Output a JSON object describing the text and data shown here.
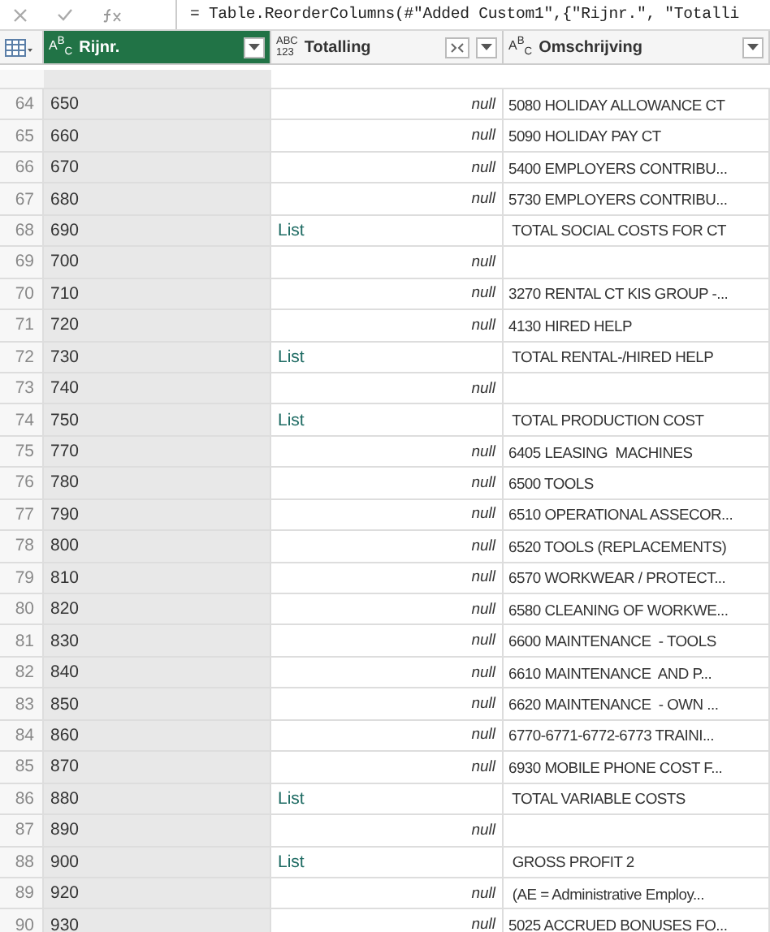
{
  "formula_bar": {
    "text": "= Table.ReorderColumns(#\"Added Custom1\",{\"Rijnr.\", \"Totalli"
  },
  "columns": [
    {
      "name": "Rijnr.",
      "kind": "text",
      "type_label": "A$^{B}$$_{C}$",
      "selected": true,
      "expandable": false
    },
    {
      "name": "Totalling",
      "kind": "any",
      "type_label": "ABC 123",
      "selected": false,
      "expandable": true
    },
    {
      "name": "Omschrijving",
      "kind": "text",
      "type_label": "A$^{B}$$_{C}$",
      "selected": false,
      "expandable": false
    }
  ],
  "rows": [
    {
      "n": "64",
      "rijnr": "650",
      "totalling": {
        "kind": "null",
        "text": "null"
      },
      "omschrijving": "5080 HOLIDAY ALLOWANCE CT"
    },
    {
      "n": "65",
      "rijnr": "660",
      "totalling": {
        "kind": "null",
        "text": "null"
      },
      "omschrijving": "5090 HOLIDAY PAY CT"
    },
    {
      "n": "66",
      "rijnr": "670",
      "totalling": {
        "kind": "null",
        "text": "null"
      },
      "omschrijving": "5400 EMPLOYERS CONTRIBU..."
    },
    {
      "n": "67",
      "rijnr": "680",
      "totalling": {
        "kind": "null",
        "text": "null"
      },
      "omschrijving": "5730 EMPLOYERS CONTRIBU..."
    },
    {
      "n": "68",
      "rijnr": "690",
      "totalling": {
        "kind": "list",
        "text": "List"
      },
      "omschrijving": " TOTAL SOCIAL COSTS FOR CT"
    },
    {
      "n": "69",
      "rijnr": "700",
      "totalling": {
        "kind": "null",
        "text": "null"
      }
    },
    {
      "n": "70",
      "rijnr": "710",
      "totalling": {
        "kind": "null",
        "text": "null"
      },
      "omschrijving": "3270 RENTAL CT KIS GROUP -..."
    },
    {
      "n": "71",
      "rijnr": "720",
      "totalling": {
        "kind": "null",
        "text": "null"
      },
      "omschrijving": "4130 HIRED HELP"
    },
    {
      "n": "72",
      "rijnr": "730",
      "totalling": {
        "kind": "list",
        "text": "List"
      },
      "omschrijving": " TOTAL RENTAL-/HIRED HELP"
    },
    {
      "n": "73",
      "rijnr": "740",
      "totalling": {
        "kind": "null",
        "text": "null"
      }
    },
    {
      "n": "74",
      "rijnr": "750",
      "totalling": {
        "kind": "list",
        "text": "List"
      },
      "omschrijving": " TOTAL PRODUCTION COST"
    },
    {
      "n": "75",
      "rijnr": "770",
      "totalling": {
        "kind": "null",
        "text": "null"
      },
      "omschrijving": "6405 LEASING  MACHINES"
    },
    {
      "n": "76",
      "rijnr": "780",
      "totalling": {
        "kind": "null",
        "text": "null"
      },
      "omschrijving": "6500 TOOLS"
    },
    {
      "n": "77",
      "rijnr": "790",
      "totalling": {
        "kind": "null",
        "text": "null"
      },
      "omschrijving": "6510 OPERATIONAL ASSECOR..."
    },
    {
      "n": "78",
      "rijnr": "800",
      "totalling": {
        "kind": "null",
        "text": "null"
      },
      "omschrijving": "6520 TOOLS (REPLACEMENTS)"
    },
    {
      "n": "79",
      "rijnr": "810",
      "totalling": {
        "kind": "null",
        "text": "null"
      },
      "omschrijving": "6570 WORKWEAR / PROTECT..."
    },
    {
      "n": "80",
      "rijnr": "820",
      "totalling": {
        "kind": "null",
        "text": "null"
      },
      "omschrijving": "6580 CLEANING OF WORKWE..."
    },
    {
      "n": "81",
      "rijnr": "830",
      "totalling": {
        "kind": "null",
        "text": "null"
      },
      "omschrijving": "6600 MAINTENANCE  - TOOLS"
    },
    {
      "n": "82",
      "rijnr": "840",
      "totalling": {
        "kind": "null",
        "text": "null"
      },
      "omschrijving": "6610 MAINTENANCE  AND P..."
    },
    {
      "n": "83",
      "rijnr": "850",
      "totalling": {
        "kind": "null",
        "text": "null"
      },
      "omschrijving": "6620 MAINTENANCE  - OWN ..."
    },
    {
      "n": "84",
      "rijnr": "860",
      "totalling": {
        "kind": "null",
        "text": "null"
      },
      "omschrijving": "6770-6771-6772-6773 TRAINI..."
    },
    {
      "n": "85",
      "rijnr": "870",
      "totalling": {
        "kind": "null",
        "text": "null"
      },
      "omschrijving": "6930 MOBILE PHONE COST F..."
    },
    {
      "n": "86",
      "rijnr": "880",
      "totalling": {
        "kind": "list",
        "text": "List"
      },
      "omschrijving": " TOTAL VARIABLE COSTS"
    },
    {
      "n": "87",
      "rijnr": "890",
      "totalling": {
        "kind": "null",
        "text": "null"
      }
    },
    {
      "n": "88",
      "rijnr": "900",
      "totalling": {
        "kind": "list",
        "text": "List"
      },
      "omschrijving": " GROSS PROFIT 2"
    },
    {
      "n": "89",
      "rijnr": "920",
      "totalling": {
        "kind": "null",
        "text": "null"
      },
      "omschrijving": " (AE = Administrative Employ..."
    },
    {
      "n": "90",
      "rijnr": "930",
      "totalling": {
        "kind": "null",
        "text": "null"
      },
      "omschrijving": "5025 ACCRUED BONUSES FO..."
    }
  ]
}
